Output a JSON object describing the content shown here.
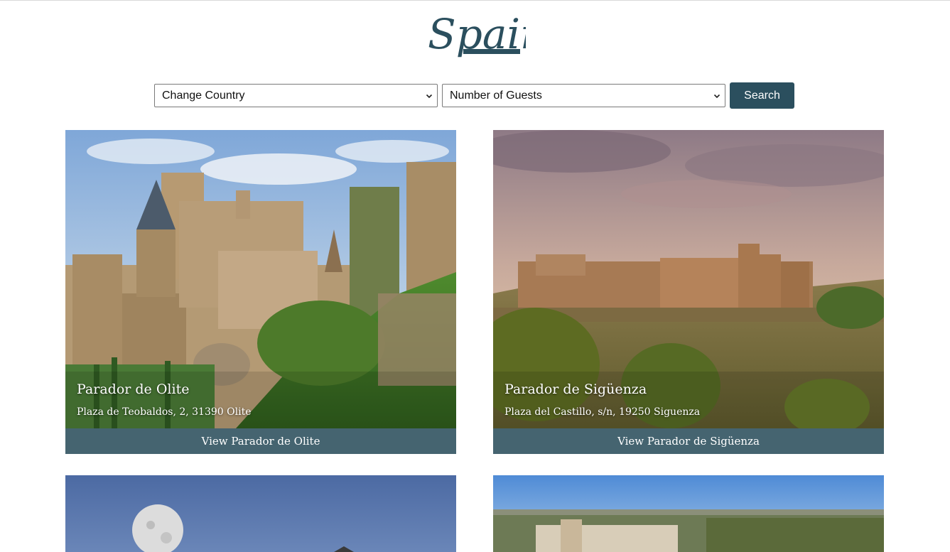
{
  "brand": {
    "title": "Spain"
  },
  "search": {
    "country_select": "Change Country",
    "guests_select": "Number of Guests",
    "button_label": "Search"
  },
  "cards": [
    {
      "name": "Parador de Olite",
      "address": "Plaza de Teobaldos, 2, 31390 Olite",
      "button": "View Parador de Olite"
    },
    {
      "name": "Parador de Sigüenza",
      "address": "Plaza del Castillo, s/n, 19250 Siguenza",
      "button": "View Parador de Sigüenza"
    }
  ],
  "colors": {
    "brand": "#2b4f5e",
    "card_button": "#456470"
  }
}
